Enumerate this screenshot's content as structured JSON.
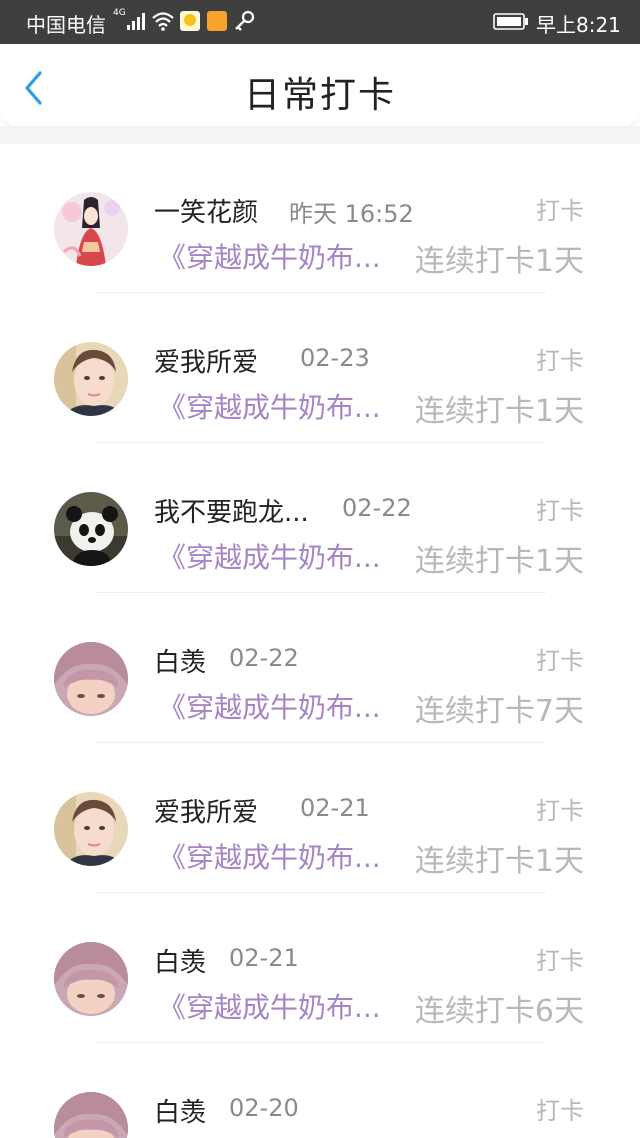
{
  "status_bar": {
    "carrier": "中国电信",
    "network_badge": "4G",
    "time": "早上8:21",
    "icons": [
      "signal-icon",
      "wifi-icon",
      "app-notification-icon",
      "app-notification-icon",
      "key-icon",
      "battery-icon"
    ]
  },
  "header": {
    "title": "日常打卡",
    "back_icon": "chevron-left-icon",
    "accent_color": "#2a9de6"
  },
  "colors": {
    "book_text": "#a685c6",
    "muted_text": "#b8b8b8",
    "date_text": "#8a8a8a"
  },
  "checkins": [
    {
      "name": "一笑花颜",
      "date": "昨天 16:52",
      "action": "打卡",
      "book": "《穿越成牛奶布...",
      "streak": "连续打卡1天",
      "avatar": "avatar-anime-girl"
    },
    {
      "name": "爱我所爱",
      "date": "02-23",
      "action": "打卡",
      "book": "《穿越成牛奶布...",
      "streak": "连续打卡1天",
      "avatar": "avatar-woman-photo"
    },
    {
      "name": "我不要跑龙...",
      "date": "02-22",
      "action": "打卡",
      "book": "《穿越成牛奶布...",
      "streak": "连续打卡1天",
      "avatar": "avatar-panda"
    },
    {
      "name": "白羡",
      "date": "02-22",
      "action": "打卡",
      "book": "《穿越成牛奶布...",
      "streak": "连续打卡7天",
      "avatar": "avatar-pink-hair"
    },
    {
      "name": "爱我所爱",
      "date": "02-21",
      "action": "打卡",
      "book": "《穿越成牛奶布...",
      "streak": "连续打卡1天",
      "avatar": "avatar-woman-photo"
    },
    {
      "name": "白羡",
      "date": "02-21",
      "action": "打卡",
      "book": "《穿越成牛奶布...",
      "streak": "连续打卡6天",
      "avatar": "avatar-pink-hair"
    },
    {
      "name": "白羡",
      "date": "02-20",
      "action": "打卡",
      "book": "",
      "streak": "",
      "avatar": "avatar-pink-hair"
    }
  ]
}
